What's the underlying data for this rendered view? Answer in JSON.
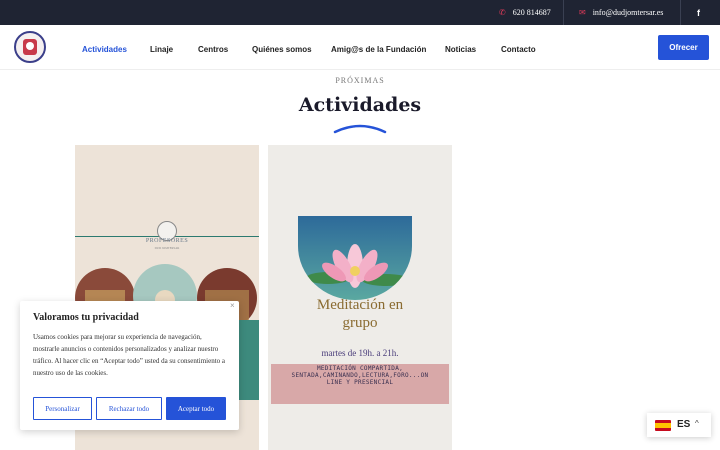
{
  "topbar": {
    "phone": "620 814687",
    "email": "info@dudjomtersar.es",
    "phone_icon": "phone-icon",
    "email_icon": "envelope-icon",
    "social_icon": "facebook-icon",
    "social_glyph": "f"
  },
  "nav": {
    "items": [
      "Actividades",
      "Linaje",
      "Centros",
      "Quiénes somos",
      "Amig@s de la Fundación",
      "Noticias",
      "Contacto"
    ],
    "active_index": 0,
    "cta_label": "Ofrecer",
    "accent_color": "#2553d8"
  },
  "section": {
    "kicker": "PRÓXIMAS",
    "title": "Actividades"
  },
  "cards": [
    {
      "label": "PROFESORES",
      "sublabel": "DUD JOMTERSAR"
    },
    {
      "heading_line1": "Meditación en",
      "heading_line2": "grupo",
      "time": "martes de 19h. a 21h.",
      "details_line1": "MEDITACIÓN COMPARTIDA,",
      "details_line2": "SENTADA,CAMINANDO,LECTURA,FORO...ON",
      "details_line3": "LINE Y PRESENCIAL"
    }
  ],
  "cookie": {
    "title": "Valoramos tu privacidad",
    "body": "Usamos cookies para mejorar su experiencia de navegación, mostrarle anuncios o contenidos personalizados y analizar nuestro tráfico. Al hacer clic en “Aceptar todo” usted da su consentimiento a nuestro uso de las cookies.",
    "close_glyph": "×",
    "customize_label": "Personalizar",
    "reject_label": "Rechazar todo",
    "accept_label": "Aceptar todo"
  },
  "language": {
    "code": "ES",
    "flag": "spain-flag-icon",
    "chevron": "^"
  }
}
